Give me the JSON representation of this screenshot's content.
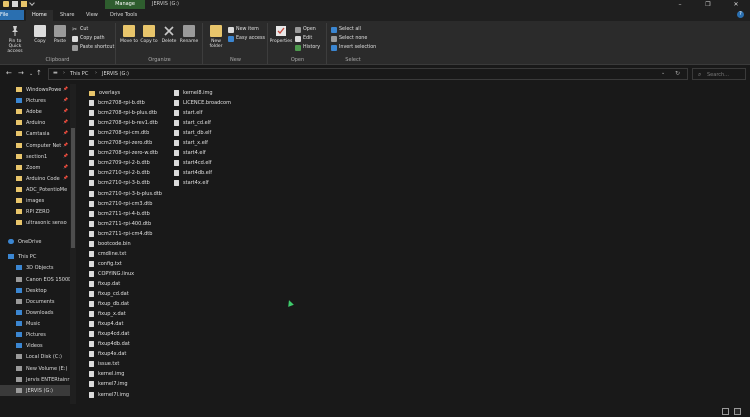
{
  "window": {
    "manage_tab": "Manage",
    "title": "JERVIS (G:)",
    "controls": [
      "–",
      "❐",
      "✕"
    ]
  },
  "tabs": {
    "file": "File",
    "home": "Home",
    "share": "Share",
    "view": "View",
    "drive_tools": "Drive Tools"
  },
  "ribbon": {
    "clipboard": {
      "label": "Clipboard",
      "pin_quick_access": "Pin to Quick access",
      "copy": "Copy",
      "paste": "Paste",
      "cut": "Cut",
      "copy_path": "Copy path",
      "paste_shortcut": "Paste shortcut"
    },
    "organize": {
      "label": "Organize",
      "move_to": "Move to",
      "copy_to": "Copy to",
      "delete": "Delete",
      "rename": "Rename"
    },
    "new": {
      "label": "New",
      "new_folder": "New folder",
      "new_item": "New item",
      "easy_access": "Easy access"
    },
    "open": {
      "label": "Open",
      "properties": "Properties",
      "open": "Open",
      "edit": "Edit",
      "history": "History"
    },
    "select": {
      "label": "Select",
      "select_all": "Select all",
      "select_none": "Select none",
      "invert_selection": "Invert selection"
    }
  },
  "address": {
    "crumbs": [
      "This PC",
      "JERVIS (G:)"
    ],
    "search_placeholder": "Search..."
  },
  "nav": [
    {
      "label": "WindowsPowe",
      "pinned": true,
      "icon": "folder"
    },
    {
      "label": "Pictures",
      "pinned": true,
      "icon": "blue"
    },
    {
      "label": "Adobe",
      "pinned": true,
      "icon": "folder"
    },
    {
      "label": "Arduino",
      "pinned": true,
      "icon": "folder"
    },
    {
      "label": "Camtasia",
      "pinned": true,
      "icon": "folder"
    },
    {
      "label": "Computer Net",
      "pinned": true,
      "icon": "folder"
    },
    {
      "label": "section1",
      "pinned": true,
      "icon": "folder"
    },
    {
      "label": "Zoom",
      "pinned": true,
      "icon": "folder"
    },
    {
      "label": "Arduino Code",
      "pinned": true,
      "icon": "folder"
    },
    {
      "label": "ADC_PotentioMe",
      "pinned": false,
      "icon": "folder"
    },
    {
      "label": "images",
      "pinned": false,
      "icon": "folder"
    },
    {
      "label": "RPI ZERO",
      "pinned": false,
      "icon": "folder"
    },
    {
      "label": "ultrasonic senso",
      "pinned": false,
      "icon": "folder"
    },
    {
      "label": "OneDrive",
      "pinned": false,
      "icon": "cloud"
    },
    {
      "label": "This PC",
      "pinned": false,
      "icon": "pc"
    },
    {
      "label": "3D Objects",
      "pinned": false,
      "icon": "blue"
    },
    {
      "label": "Canon EOS 1500D",
      "pinned": false,
      "icon": "gray"
    },
    {
      "label": "Desktop",
      "pinned": false,
      "icon": "blue"
    },
    {
      "label": "Documents",
      "pinned": false,
      "icon": "gray"
    },
    {
      "label": "Downloads",
      "pinned": false,
      "icon": "blue"
    },
    {
      "label": "Music",
      "pinned": false,
      "icon": "blue"
    },
    {
      "label": "Pictures",
      "pinned": false,
      "icon": "blue"
    },
    {
      "label": "Videos",
      "pinned": false,
      "icon": "blue"
    },
    {
      "label": "Local Disk (C:)",
      "pinned": false,
      "icon": "gray"
    },
    {
      "label": "New Volume (E:)",
      "pinned": false,
      "icon": "gray"
    },
    {
      "label": "Jervis ENTERtainr",
      "pinned": false,
      "icon": "gray"
    },
    {
      "label": "JERVIS (G:)",
      "pinned": false,
      "icon": "gray",
      "selected": true
    }
  ],
  "files_col1": [
    {
      "name": "overlays",
      "type": "folder"
    },
    {
      "name": "bcm2708-rpi-b.dtb",
      "type": "file"
    },
    {
      "name": "bcm2708-rpi-b-plus.dtb",
      "type": "file"
    },
    {
      "name": "bcm2708-rpi-b-rev1.dtb",
      "type": "file"
    },
    {
      "name": "bcm2708-rpi-cm.dtb",
      "type": "file"
    },
    {
      "name": "bcm2708-rpi-zero.dtb",
      "type": "file"
    },
    {
      "name": "bcm2708-rpi-zero-w.dtb",
      "type": "file"
    },
    {
      "name": "bcm2709-rpi-2-b.dtb",
      "type": "file"
    },
    {
      "name": "bcm2710-rpi-2-b.dtb",
      "type": "file"
    },
    {
      "name": "bcm2710-rpi-3-b.dtb",
      "type": "file"
    },
    {
      "name": "bcm2710-rpi-3-b-plus.dtb",
      "type": "file"
    },
    {
      "name": "bcm2710-rpi-cm3.dtb",
      "type": "file"
    },
    {
      "name": "bcm2711-rpi-4-b.dtb",
      "type": "file"
    },
    {
      "name": "bcm2711-rpi-400.dtb",
      "type": "file"
    },
    {
      "name": "bcm2711-rpi-cm4.dtb",
      "type": "file"
    },
    {
      "name": "bootcode.bin",
      "type": "file"
    },
    {
      "name": "cmdline.txt",
      "type": "file"
    },
    {
      "name": "config.txt",
      "type": "file"
    },
    {
      "name": "COPYING.linux",
      "type": "file"
    },
    {
      "name": "fixup.dat",
      "type": "file"
    },
    {
      "name": "fixup_cd.dat",
      "type": "file"
    },
    {
      "name": "fixup_db.dat",
      "type": "file"
    },
    {
      "name": "fixup_x.dat",
      "type": "file"
    },
    {
      "name": "fixup4.dat",
      "type": "file"
    },
    {
      "name": "fixup4cd.dat",
      "type": "file"
    },
    {
      "name": "fixup4db.dat",
      "type": "file"
    },
    {
      "name": "fixup4x.dat",
      "type": "file"
    },
    {
      "name": "issue.txt",
      "type": "file"
    },
    {
      "name": "kernel.img",
      "type": "file"
    },
    {
      "name": "kernel7.img",
      "type": "file"
    },
    {
      "name": "kernel7l.img",
      "type": "file"
    }
  ],
  "files_col2": [
    {
      "name": "kernel8.img",
      "type": "file"
    },
    {
      "name": "LICENCE.broadcom",
      "type": "file"
    },
    {
      "name": "start.elf",
      "type": "file"
    },
    {
      "name": "start_cd.elf",
      "type": "file"
    },
    {
      "name": "start_db.elf",
      "type": "file"
    },
    {
      "name": "start_x.elf",
      "type": "file"
    },
    {
      "name": "start4.elf",
      "type": "file"
    },
    {
      "name": "start4cd.elf",
      "type": "file"
    },
    {
      "name": "start4db.elf",
      "type": "file"
    },
    {
      "name": "start4x.elf",
      "type": "file"
    }
  ],
  "colors": {
    "background": "#191919",
    "ribbon": "#2b2b2b",
    "file_tab": "#2a6fb0",
    "manage_tab": "#2e5d2e",
    "folder": "#e8c56b"
  }
}
